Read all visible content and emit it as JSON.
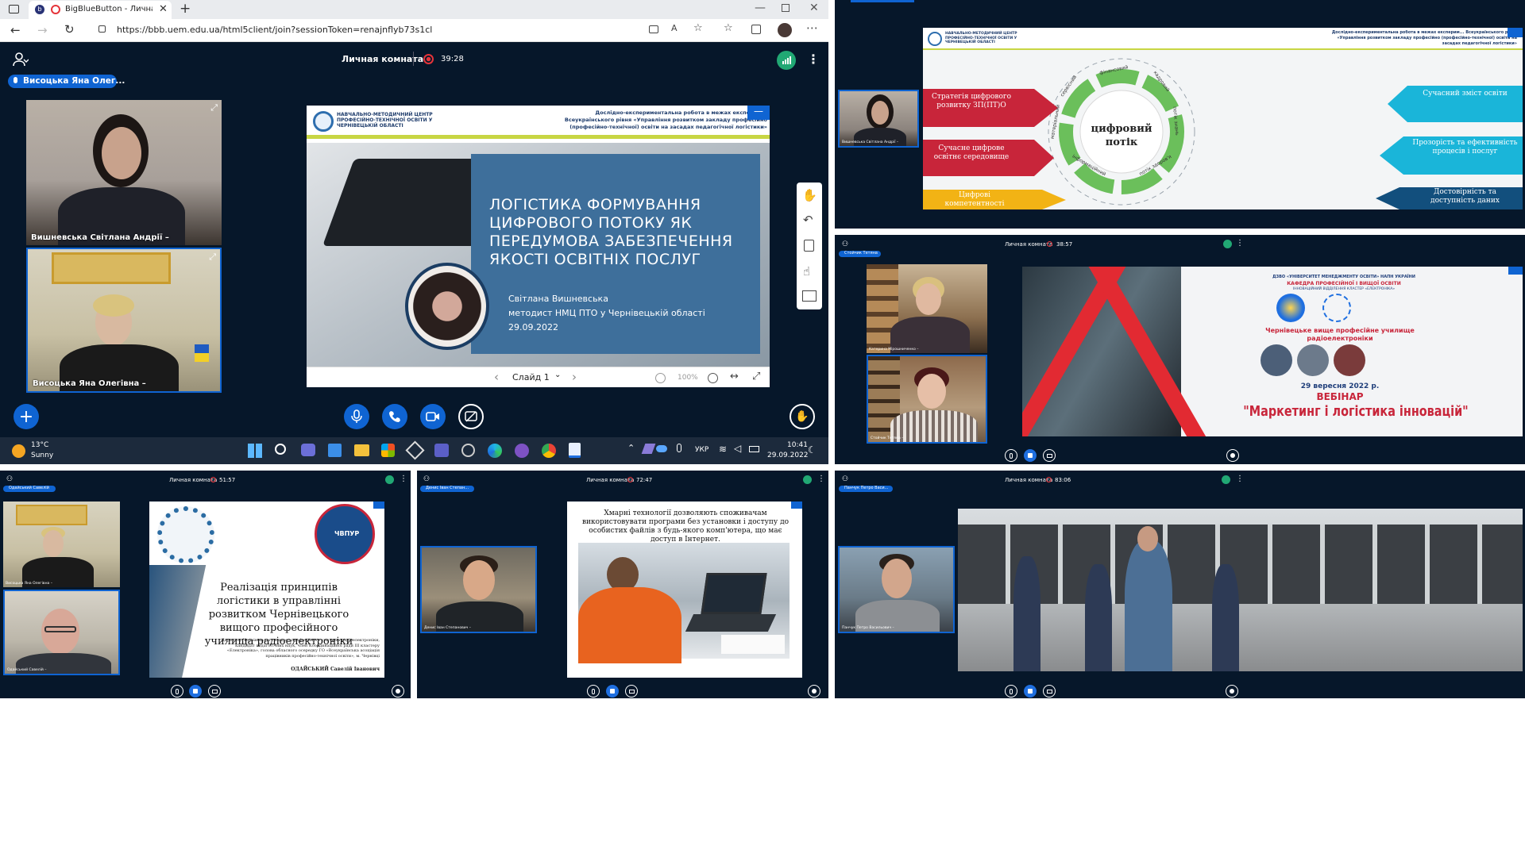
{
  "browser": {
    "tab_title": "BigBlueButton - Личная ко...",
    "url": "https://bbb.uem.edu.ua/html5client/join?sessionToken=renajnflyb73s1cl"
  },
  "meeting": {
    "room_title": "Личная комната",
    "timer": "39:28",
    "talking_badge": "Висоцька Яна Олег..."
  },
  "videos": [
    {
      "name": "Вишневська Світлана Андрії –"
    },
    {
      "name": "Висоцька Яна Олегівна –"
    }
  ],
  "slide": {
    "org_name": "НАВЧАЛЬНО-МЕТОДИЧНИЙ ЦЕНТР ПРОФЕСІЙНО-ТЕХНІЧНОЇ ОСВІТИ У ЧЕРНІВЕЦЬКІЙ ОБЛАСТІ",
    "header_text": "Дослідно-експериментальна робота в межах експерим... Всеукраїнського рівня «Управління розвитком закладу професійно (професійно-технічної) освіти на засадах педагогічної логістики»",
    "title": "ЛОГІСТИКА ФОРМУВАННЯ ЦИФРОВОГО ПОТОКУ ЯК ПЕРЕДУМОВА ЗАБЕЗПЕЧЕННЯ ЯКОСТІ ОСВІТНІХ ПОСЛУГ",
    "author": "Світлана Вишневська",
    "position": "методист НМЦ ПТО у Чернівецькій області",
    "date": "29.09.2022"
  },
  "slide_controls": {
    "slide_label": "Слайд 1",
    "zoom": "100%"
  },
  "taskbar": {
    "weather_temp": "13°C",
    "weather_desc": "Sunny",
    "lang": "УКР",
    "time": "10:41",
    "date": "29.09.2022"
  },
  "tr_slide": {
    "center_line1": "цифровий",
    "center_line2": "потік",
    "org_name": "НАВЧАЛЬНО-МЕТОДИЧНИЙ ЦЕНТР ПРОФЕСІЙНО-ТЕХНІЧНОЇ ОСВІТИ У ЧЕРНІВЕЦЬКІЙ ОБЛАСТІ",
    "header_text": "Дослідно-експериментальна робота в межах експерим... Всеукраїнського рівня «Управління розвитком закладу професійно (професійно-технічної) освіти на засадах педагогічної логістики»",
    "items": [
      "Стратегія цифрового розвитку ЗП(ПТ)О",
      "Сучасне цифрове освітнє середовище",
      "Цифрові компетентності",
      "Сучасний зміст освіти",
      "Прозорість та ефективність процесів і послуг",
      "Достовірність та доступність даних"
    ],
    "ring_words": [
      "матеріальний",
      "сервісний",
      "фінансовий",
      "кадровий",
      "потік знань",
      "потік здоров'я",
      "інформаційний"
    ],
    "video_name": "Вишневська Світлана Андрії –"
  },
  "mr": {
    "room_title": "Личная комната",
    "timer": "38:57",
    "badge": "Стойчик Тетяна",
    "video1_name": "Катерина Мірошниченко –",
    "video2_name": "Стойчик Тетяна –",
    "slide_org": "ДЗВО «УНІВЕРСИТЕТ МЕНЕДЖМЕНТУ ОСВІТИ» НАПН УКРАЇНИ",
    "slide_dept": "КАФЕДРА ПРОФЕСІЙНОЇ І ВИЩОЇ ОСВІТИ",
    "slide_sub": "ІННОВАЦІЙНИЙ ВІДДІЛЕННЯ КЛАСТЕР «ЕЛЕКТРОНІКА»",
    "slide_school": "Чернівецьке вище професійне училище радіоелектроніки",
    "slide_date": "29 вересня 2022 р.",
    "slide_kind": "ВЕБІНАР",
    "slide_topic": "\"Маркетинг і логістика інновацій\""
  },
  "bl": {
    "room_title": "Личная комната",
    "timer": "51:57",
    "badge": "Одайський Савелій",
    "video1_name": "Висоцька Яна Олегівна –",
    "video2_name": "Одайський Савелій –",
    "slide_title": "Реалізація принципів логістики в управлінні розвитком Чернівецького вищого професійного училища радіоелектроніки",
    "slide_logo": "ЧВПУР",
    "slide_desc": "Директор Чернівецького вищого професійного училища радіоелектроніки, кандидат педагогічних наук, член Координаційної ради ІІІ кластеру «Електроніка», голова обласного осередку ГО «Всеукраїнська асоціація працівників професійно-технічної освіти», м. Чернівці",
    "slide_author": "ОДАЙСЬКИЙ Савелій Іванович"
  },
  "bm": {
    "room_title": "Личная комната",
    "timer": "72:47",
    "badge": "Денис Іван Степан...",
    "video_name": "Денис Іван Степанович –",
    "slide_text": "Хмарні технології дозволяють споживачам використовувати програми без установки і доступу до особистих файлів з будь-якого комп'ютера, що має доступ в Інтернет."
  },
  "br": {
    "room_title": "Личная комната",
    "timer": "83:06",
    "badge": "Панчук Петро Васи...",
    "video_name": "Панчук Петро Васильович –"
  },
  "colors": {
    "bg": "#06172a",
    "accent": "#0f64d2",
    "record": "#e5343a",
    "connection": "#21a874"
  }
}
